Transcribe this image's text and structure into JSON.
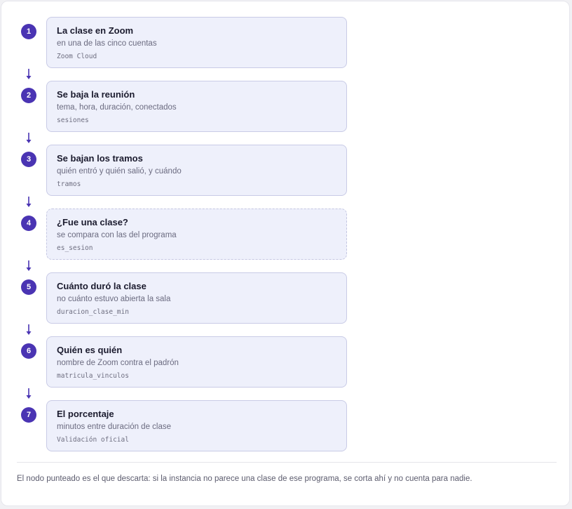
{
  "colors": {
    "accent": "#4a34b3",
    "card_background": "#eef0fb",
    "card_border": "#c9cbe6"
  },
  "steps": [
    {
      "number": "1",
      "title": "La clase en Zoom",
      "subtitle": "en una de las cinco cuentas",
      "code": "Zoom Cloud",
      "dashed": false
    },
    {
      "number": "2",
      "title": "Se baja la reunión",
      "subtitle": "tema, hora, duración, conectados",
      "code": "sesiones",
      "dashed": false
    },
    {
      "number": "3",
      "title": "Se bajan los tramos",
      "subtitle": "quién entró y quién salió, y cuándo",
      "code": "tramos",
      "dashed": false
    },
    {
      "number": "4",
      "title": "¿Fue una clase?",
      "subtitle": "se compara con las del programa",
      "code": "es_sesion",
      "dashed": true
    },
    {
      "number": "5",
      "title": "Cuánto duró la clase",
      "subtitle": "no cuánto estuvo abierta la sala",
      "code": "duracion_clase_min",
      "dashed": false
    },
    {
      "number": "6",
      "title": "Quién es quién",
      "subtitle": "nombre de Zoom contra el padrón",
      "code": "matricula_vinculos",
      "dashed": false
    },
    {
      "number": "7",
      "title": "El porcentaje",
      "subtitle": "minutos entre duración de clase",
      "code": "Validación oficial",
      "dashed": false
    }
  ],
  "footnote": "El nodo punteado es el que descarta: si la instancia no parece una clase de ese programa, se corta ahí y no cuenta para nadie."
}
